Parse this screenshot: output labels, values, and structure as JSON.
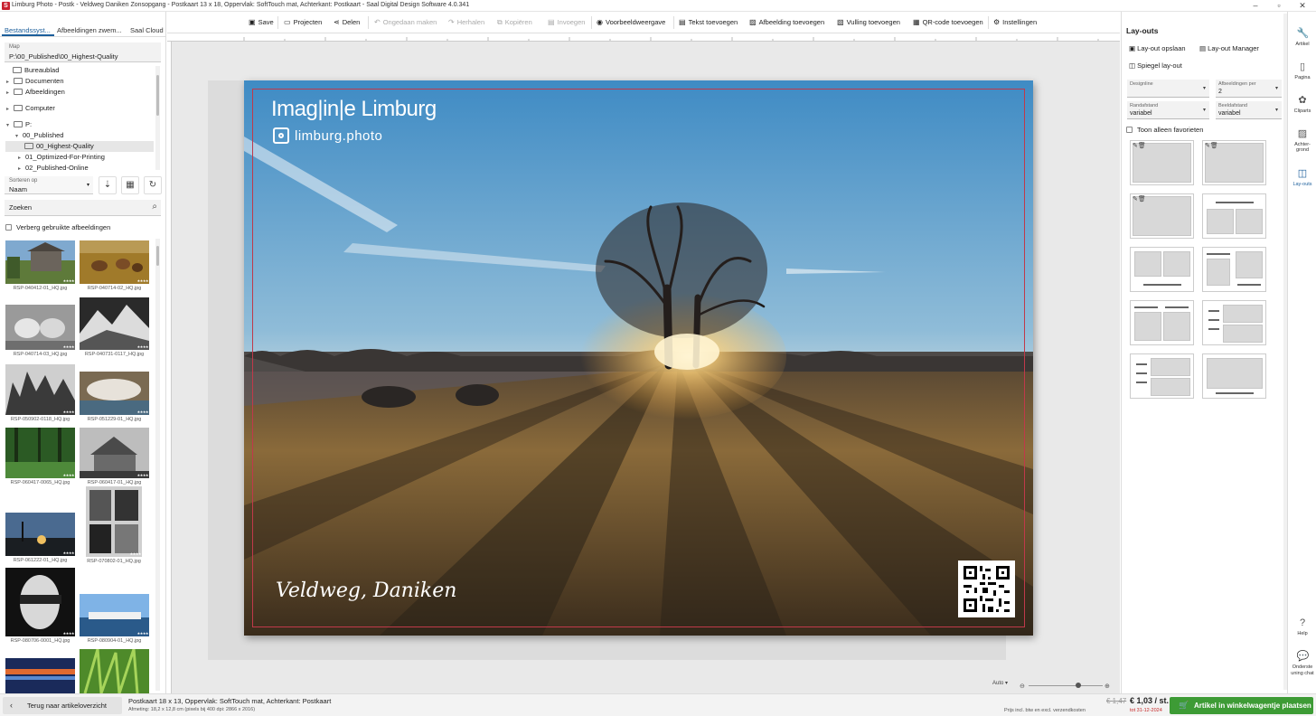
{
  "window": {
    "title": "Limburg Photo - Postk - Veldweg Daniken Zonsopgang - Postkaart 13 x 18, Oppervlak: SoftTouch mat, Achterkant: Postkaart - Saal Digital Design Software 4.0.341",
    "app_icon": "S"
  },
  "left_panel": {
    "tabs": [
      "Bestandssyst...",
      "Afbeeldingen zwem...",
      "Saal Cloud"
    ],
    "path_label": "Map",
    "path_value": "P:\\00_Published\\00_Highest-Quality",
    "tree": [
      {
        "label": "Bureaublad",
        "icon": "desktop-icon"
      },
      {
        "label": "Documenten",
        "icon": "folder-icon"
      },
      {
        "label": "Afbeeldingen",
        "icon": "folder-icon"
      },
      {
        "label": "Computer",
        "icon": "computer-icon"
      },
      {
        "label": "P:",
        "icon": "folder-icon"
      },
      {
        "label": "00_Published",
        "icon": "folder-icon"
      },
      {
        "label": "00_Highest-Quality",
        "icon": "folder-icon"
      },
      {
        "label": "01_Optimized-For-Printing",
        "icon": "folder-icon"
      },
      {
        "label": "02_Published-Online",
        "icon": "folder-icon"
      }
    ],
    "sort_label": "Sorteren op",
    "sort_value": "Naam",
    "search_label": "Zoeken",
    "hide_used_label": "Verberg gebruikte afbeeldingen",
    "thumbnails": [
      "RSP-040412-01_HQ.jpg",
      "RSP-040714-02_HQ.jpg",
      "RSP-040714-03_HQ.jpg",
      "RSP-040731-0117_HQ.jpg",
      "RSP-050902-0118_HQ.jpg",
      "RSP-051229-01_HQ.jpg",
      "RSP-060417-0065_HQ.jpg",
      "RSP-060417-01_HQ.jpg",
      "RSP-061222-01_HQ.jpg",
      "RSP-070802-01_HQ.jpg",
      "RSP-080706-0001_HQ.jpg",
      "RSP-080904-01_HQ.jpg",
      "",
      ""
    ],
    "stars": "★★★★"
  },
  "toolbar": {
    "save": "Save",
    "projects": "Projecten",
    "share": "Delen",
    "undo": "Ongedaan maken",
    "redo": "Herhalen",
    "copy": "Kopiëren",
    "paste": "Invoegen",
    "preview": "Voorbeeldweergave",
    "add_text": "Tekst toevoegen",
    "add_image": "Afbeelding toevoegen",
    "add_fill": "Vulling toevoegen",
    "add_qr": "QR-code toevoegen",
    "settings": "Instellingen"
  },
  "postcard": {
    "brand_title": "Imag|in|e Limburg",
    "brand_url": "limburg.photo",
    "caption": "Veldweg, Daniken"
  },
  "right_panel": {
    "title": "Lay-outs",
    "save_layout": "Lay-out opslaan",
    "layout_manager": "Lay-out Manager",
    "mirror_layout": "Spiegel lay-out",
    "designline_label": "Designline",
    "designline_value": "",
    "images_per_label": "Afbeeldingen per",
    "images_per_value": "2",
    "margin_label": "Randafstand",
    "margin_value": "variabel",
    "spacing_label": "Beeldafstand",
    "spacing_value": "variabel",
    "favorites_label": "Toon alleen favorieten"
  },
  "side_icons": [
    {
      "label": "Artikel",
      "icon": "wrench-icon"
    },
    {
      "label": "Pagina",
      "icon": "page-icon"
    },
    {
      "label": "Cliparts",
      "icon": "clipart-icon"
    },
    {
      "label": "Achter-grond",
      "icon": "background-icon"
    },
    {
      "label": "Lay-outs",
      "icon": "layout-icon"
    }
  ],
  "side_bottom": {
    "help": "Help",
    "support": "Onderste uning chat"
  },
  "canvas": {
    "zoom_value": "Auto"
  },
  "bottom": {
    "back": "Terug naar artikeloverzicht",
    "product": "Postkaart 18 x 13, Oppervlak: SoftTouch mat, Achterkant: Postkaart",
    "dimensions": "Afmeting: 18,2 x 12,8 cm (pixels bij 400 dpi: 2866 x 2016)",
    "old_price": "€ 1,47",
    "price": "€ 1,03 / st.",
    "price_note": "Prijs incl. btw en excl. verzendkosten",
    "valid_until": "tot 31-12-2024",
    "cart": "Artikel in winkelwagentje plaatsen"
  },
  "colors": {
    "accent": "#1b5e9b",
    "cart_green": "#3d9b35",
    "price_red": "#c62828"
  }
}
